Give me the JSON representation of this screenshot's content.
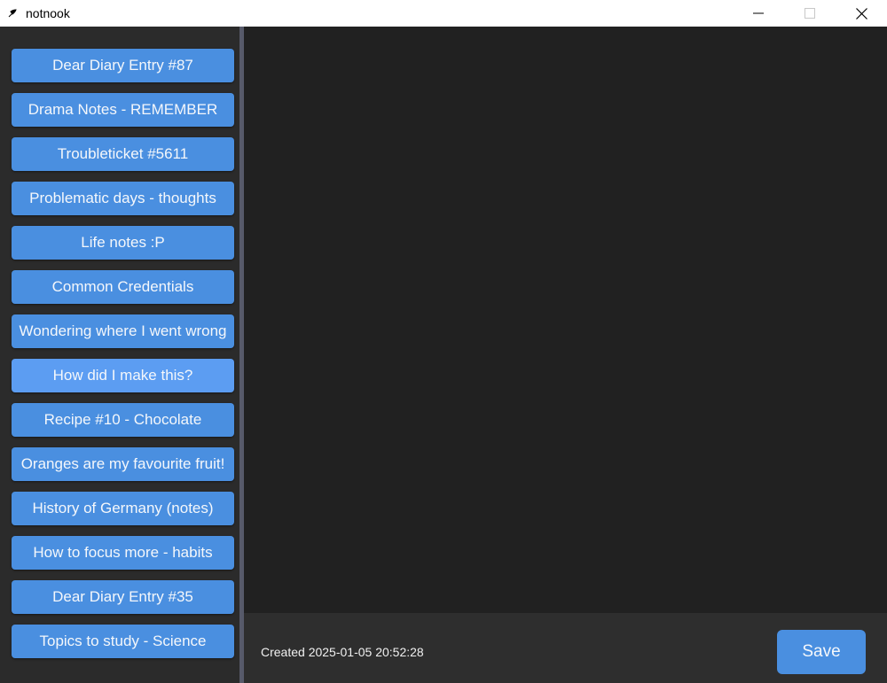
{
  "window": {
    "title": "notnook"
  },
  "sidebar": {
    "notes": [
      {
        "label": "Dear Diary Entry #87"
      },
      {
        "label": "Drama Notes - REMEMBER"
      },
      {
        "label": "Troubleticket #5611"
      },
      {
        "label": "Problematic days - thoughts"
      },
      {
        "label": "Life notes :P"
      },
      {
        "label": "Common Credentials"
      },
      {
        "label": "Wondering where I went wrong"
      },
      {
        "label": "How did I make this?"
      },
      {
        "label": "Recipe #10 - Chocolate"
      },
      {
        "label": "Oranges are my favourite fruit!"
      },
      {
        "label": "History of Germany (notes)"
      },
      {
        "label": "How to focus more - habits"
      },
      {
        "label": "Dear Diary Entry #35"
      },
      {
        "label": "Topics to study - Science"
      }
    ],
    "hovered_index": 7
  },
  "footer": {
    "created": "Created 2025-01-05 20:52:28",
    "save_label": "Save"
  },
  "colors": {
    "button": "#4a8fe0",
    "button_hover": "#5c9df2",
    "editor_bg": "#212121",
    "sidebar_bg": "#2b2b2b"
  },
  "icons": {
    "app": "feather-icon",
    "minimize": "minimize-icon",
    "maximize": "maximize-icon",
    "close": "close-icon"
  }
}
